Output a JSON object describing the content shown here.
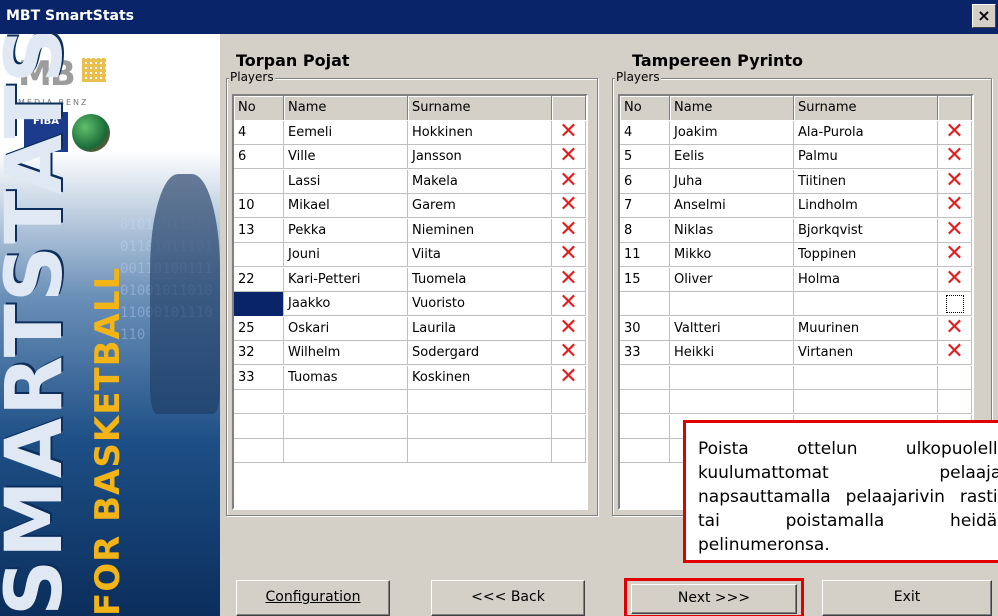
{
  "window": {
    "title": "MBT SmartStats",
    "close_label": "×"
  },
  "sidebar": {
    "logo_text": "MB",
    "logo_sub": "MEDIA BENZ",
    "fiba_text": "FIBA",
    "vertical_title": "SMARTSTATS",
    "vertical_sub": "FOR BASKETBALL",
    "binary_text": "0101101100101101011101001101001110100101101011000101110110"
  },
  "home": {
    "team_name": "Torpan Pojat",
    "group_label": "Players",
    "columns": [
      "No",
      "Name",
      "Surname",
      ""
    ],
    "players": [
      {
        "no": "4",
        "name": "Eemeli",
        "surname": "Hokkinen",
        "delete": "✕"
      },
      {
        "no": "6",
        "name": "Ville",
        "surname": "Jansson",
        "delete": "✕"
      },
      {
        "no": "",
        "name": "Lassi",
        "surname": "Makela",
        "delete": "✕"
      },
      {
        "no": "10",
        "name": "Mikael",
        "surname": "Garem",
        "delete": "✕"
      },
      {
        "no": "13",
        "name": "Pekka",
        "surname": "Nieminen",
        "delete": "✕"
      },
      {
        "no": "",
        "name": "Jouni",
        "surname": "Viita",
        "delete": "✕"
      },
      {
        "no": "22",
        "name": "Kari-Petteri",
        "surname": "Tuomela",
        "delete": "✕"
      },
      {
        "no": "",
        "name": "Jaakko",
        "surname": "Vuoristo",
        "delete": "✕"
      },
      {
        "no": "25",
        "name": "Oskari",
        "surname": "Laurila",
        "delete": "✕"
      },
      {
        "no": "32",
        "name": "Wilhelm",
        "surname": "Sodergard",
        "delete": "✕"
      },
      {
        "no": "33",
        "name": "Tuomas",
        "surname": "Koskinen",
        "delete": "✕"
      },
      {
        "no": "",
        "name": "",
        "surname": "",
        "delete": ""
      },
      {
        "no": "",
        "name": "",
        "surname": "",
        "delete": ""
      },
      {
        "no": "",
        "name": "",
        "surname": "",
        "delete": ""
      }
    ]
  },
  "away": {
    "team_name": "Tampereen Pyrinto",
    "group_label": "Players",
    "columns": [
      "No",
      "Name",
      "Surname",
      ""
    ],
    "players": [
      {
        "no": "4",
        "name": "Joakim",
        "surname": "Ala-Purola",
        "delete": "✕"
      },
      {
        "no": "5",
        "name": "Eelis",
        "surname": "Palmu",
        "delete": "✕"
      },
      {
        "no": "6",
        "name": "Juha",
        "surname": "Tiitinen",
        "delete": "✕"
      },
      {
        "no": "7",
        "name": "Anselmi",
        "surname": "Lindholm",
        "delete": "✕"
      },
      {
        "no": "8",
        "name": "Niklas",
        "surname": "Bjorkqvist",
        "delete": "✕"
      },
      {
        "no": "11",
        "name": "Mikko",
        "surname": "Toppinen",
        "delete": "✕"
      },
      {
        "no": "15",
        "name": "Oliver",
        "surname": "Holma",
        "delete": "✕"
      },
      {
        "no": "",
        "name": "",
        "surname": "",
        "delete": ""
      },
      {
        "no": "30",
        "name": "Valtteri",
        "surname": "Muurinen",
        "delete": "✕"
      },
      {
        "no": "33",
        "name": "Heikki",
        "surname": "Virtanen",
        "delete": "✕"
      },
      {
        "no": "",
        "name": "",
        "surname": "",
        "delete": ""
      },
      {
        "no": "",
        "name": "",
        "surname": "",
        "delete": ""
      },
      {
        "no": "",
        "name": "",
        "surname": "",
        "delete": ""
      },
      {
        "no": "",
        "name": "",
        "surname": "",
        "delete": ""
      }
    ]
  },
  "buttons": {
    "configuration": "Configuration",
    "back": "<<< Back",
    "next": "Next >>>",
    "exit": "Exit"
  },
  "note": {
    "text": "Poista ottelun ulkopuolelle kuulumattomat pelaajat napsauttamalla pelaajarivin rastia tai poistamalla heidän pelinumeronsa."
  },
  "colors": {
    "title_bar": "#0a246a",
    "delete_mark": "#e02020",
    "highlight": "#e00000",
    "selection": "#0a246a"
  }
}
